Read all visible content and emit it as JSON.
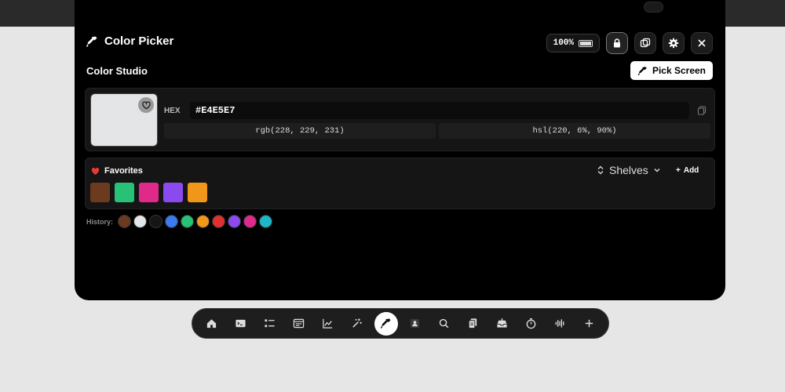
{
  "app": {
    "title": "Color Picker",
    "battery": "100%"
  },
  "studio": {
    "title": "Color Studio",
    "pick_screen_label": "Pick Screen"
  },
  "color": {
    "hex_label": "HEX",
    "hex_value": "#E4E5E7",
    "rgb": "rgb(228, 229, 231)",
    "hsl": "hsl(220, 6%, 90%)",
    "swatch": "#e4e5e7"
  },
  "favorites": {
    "title": "Favorites",
    "shelves_label": "Shelves",
    "add_label": "Add",
    "swatches": [
      "#6b3a1f",
      "#27c275",
      "#df2a8a",
      "#8b4af0",
      "#f0961b"
    ]
  },
  "history": {
    "label": "History:",
    "swatches": [
      "#6b3a1f",
      "#e4e5e7",
      "#151515",
      "#3a7bf0",
      "#27c275",
      "#f0961b",
      "#e03030",
      "#8b4af0",
      "#df2a8a",
      "#1cb8c8"
    ]
  },
  "dock": {
    "items": [
      "home",
      "terminal",
      "checklist",
      "browser",
      "chart",
      "magic-wand",
      "color-picker",
      "contacts",
      "search",
      "clipboard",
      "inbox",
      "timer",
      "audio-waveform",
      "add"
    ],
    "active": "color-picker"
  },
  "colors": {
    "accent": "#ffffff",
    "panel": "#000000",
    "card": "#151515",
    "heart": "#e23a3a"
  }
}
